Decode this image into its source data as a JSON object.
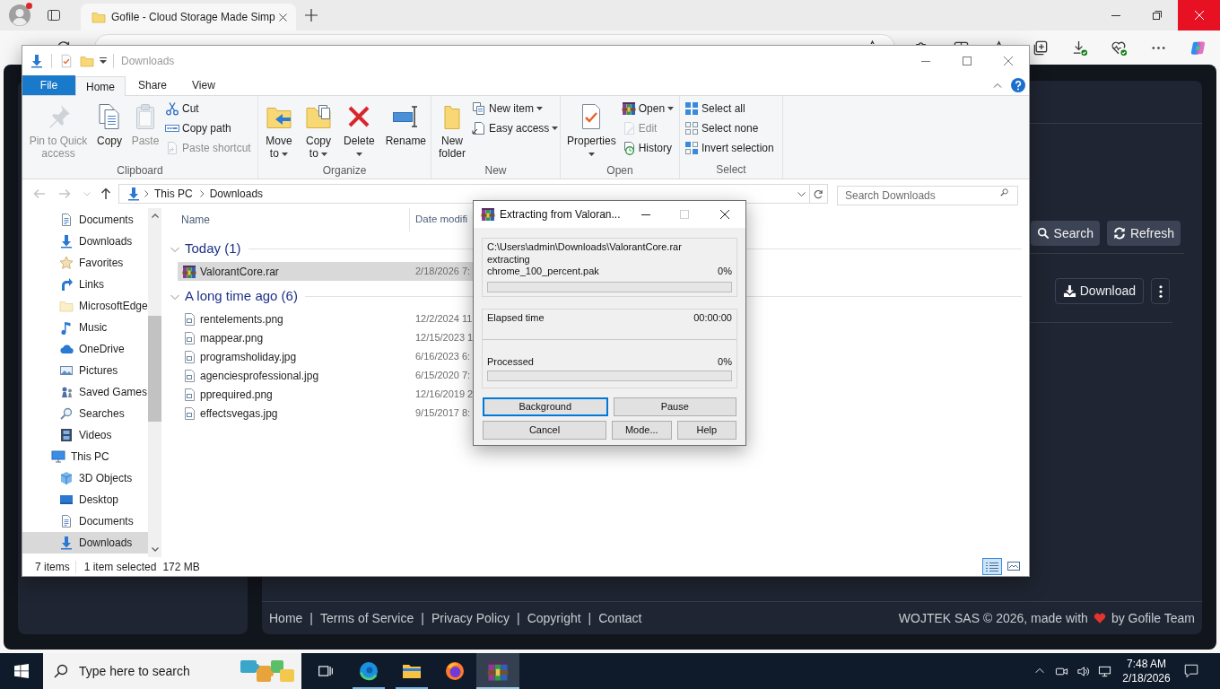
{
  "browser": {
    "profile": {
      "alert": true
    },
    "tabs": [
      {
        "title": "Gofile - Cloud Storage Made Simp",
        "selected": true
      }
    ],
    "close_hovered": true
  },
  "web_page": {
    "toolbar": [
      {
        "kind": "search",
        "label": "Search"
      },
      {
        "kind": "refresh",
        "label": "Refresh"
      }
    ],
    "file_actions": [
      {
        "kind": "download",
        "label": "Download"
      },
      {
        "kind": "more"
      }
    ],
    "footer": {
      "links": [
        "Home",
        "Terms of Service",
        "Privacy Policy",
        "Copyright",
        "Contact"
      ],
      "separator": "|",
      "credit": [
        "WOJTEK SAS © 2026, made with",
        "by Gofile Team"
      ]
    }
  },
  "explorer": {
    "title": "Downloads",
    "ribbon_tabs": [
      {
        "label": "File",
        "kind": "file",
        "selected": false
      },
      {
        "label": "Home",
        "kind": "tab",
        "selected": true
      },
      {
        "label": "Share",
        "kind": "tab",
        "selected": false
      },
      {
        "label": "View",
        "kind": "tab",
        "selected": false
      }
    ],
    "ribbon_groups": [
      {
        "label": "Clipboard",
        "large": [
          {
            "label": "Pin to Quick access",
            "kind": "pin",
            "disabled": true,
            "dropdown": false
          },
          {
            "label": "Copy",
            "kind": "copy",
            "disabled": false,
            "dropdown": false
          },
          {
            "label": "Paste",
            "kind": "paste",
            "disabled": true,
            "dropdown": false
          }
        ],
        "small": [
          {
            "label": "Cut",
            "kind": "cut",
            "disabled": false,
            "dropdown": false
          },
          {
            "label": "Copy path",
            "kind": "copy-path",
            "disabled": false,
            "dropdown": false
          },
          {
            "label": "Paste shortcut",
            "kind": "paste-shortcut",
            "disabled": true,
            "dropdown": false
          }
        ]
      },
      {
        "label": "Organize",
        "large": [
          {
            "label": "Move to",
            "kind": "move-to",
            "disabled": false,
            "dropdown": true
          },
          {
            "label": "Copy to",
            "kind": "copy-to",
            "disabled": false,
            "dropdown": true
          },
          {
            "label": "Delete",
            "kind": "delete",
            "disabled": false,
            "dropdown": true
          },
          {
            "label": "Rename",
            "kind": "rename",
            "disabled": false,
            "dropdown": false
          }
        ]
      },
      {
        "label": "New",
        "large": [
          {
            "label": "New folder",
            "kind": "new-folder",
            "disabled": false,
            "dropdown": false
          }
        ],
        "small": [
          {
            "label": "New item",
            "kind": "new-item",
            "disabled": false,
            "dropdown": true
          },
          {
            "label": "Easy access",
            "kind": "easy-access",
            "disabled": false,
            "dropdown": true
          }
        ]
      },
      {
        "label": "Open",
        "large": [
          {
            "label": "Properties",
            "kind": "properties",
            "disabled": false,
            "dropdown": true
          }
        ],
        "small": [
          {
            "label": "Open",
            "kind": "open",
            "disabled": false,
            "dropdown": true
          },
          {
            "label": "Edit",
            "kind": "edit",
            "disabled": true,
            "dropdown": false
          },
          {
            "label": "History",
            "kind": "history",
            "disabled": false,
            "dropdown": false
          }
        ]
      },
      {
        "label": "Select",
        "small": [
          {
            "label": "Select all",
            "kind": "select-all",
            "disabled": false,
            "dropdown": false
          },
          {
            "label": "Select none",
            "kind": "select-none",
            "disabled": false,
            "dropdown": false
          },
          {
            "label": "Invert selection",
            "kind": "invert-selection",
            "disabled": false,
            "dropdown": false
          }
        ]
      }
    ],
    "nav_buttons": [
      {
        "kind": "back",
        "disabled": true
      },
      {
        "kind": "forward",
        "disabled": true
      },
      {
        "kind": "recent",
        "disabled": true
      },
      {
        "kind": "up",
        "disabled": false
      }
    ],
    "address": {
      "path": [
        "This PC",
        "Downloads"
      ]
    },
    "search": {
      "placeholder": "Search Downloads"
    },
    "nav_pane": {
      "tree": [
        {
          "children": [
            {
              "label": "Documents",
              "kind": "documents",
              "selected": false
            },
            {
              "label": "Downloads",
              "kind": "downloads",
              "selected": false
            },
            {
              "label": "Favorites",
              "kind": "favorites",
              "selected": false
            },
            {
              "label": "Links",
              "kind": "links",
              "selected": false
            },
            {
              "label": "MicrosoftEdge",
              "kind": "folder",
              "selected": false
            },
            {
              "label": "Music",
              "kind": "music",
              "selected": false
            },
            {
              "label": "OneDrive",
              "kind": "onedrive",
              "selected": false
            },
            {
              "label": "Pictures",
              "kind": "pictures",
              "selected": false
            },
            {
              "label": "Saved Games",
              "kind": "saved-games",
              "selected": false
            },
            {
              "label": "Searches",
              "kind": "searches",
              "selected": false
            },
            {
              "label": "Videos",
              "kind": "videos",
              "selected": false
            }
          ]
        },
        {
          "label": "This PC",
          "kind": "this-pc",
          "selected": false,
          "children": [
            {
              "label": "3D Objects",
              "kind": "objects",
              "selected": false
            },
            {
              "label": "Desktop",
              "kind": "desktop",
              "selected": false
            },
            {
              "label": "Documents",
              "kind": "documents",
              "selected": false
            },
            {
              "label": "Downloads",
              "kind": "downloads",
              "selected": true
            }
          ]
        }
      ]
    },
    "columns": [
      "Name",
      "Date modifi"
    ],
    "groups": [
      {
        "label": "Today (1)",
        "expanded": true,
        "files": [
          {
            "name": "ValorantCore.rar",
            "date": "2/18/2026 7:",
            "kind": "archive",
            "selected": true
          }
        ]
      },
      {
        "label": "A long time ago (6)",
        "expanded": true,
        "files": [
          {
            "name": "rentelements.png",
            "date": "12/2/2024 11",
            "kind": "image",
            "selected": false
          },
          {
            "name": "mappear.png",
            "date": "12/15/2023 1",
            "kind": "image",
            "selected": false
          },
          {
            "name": "programsholiday.jpg",
            "date": "6/16/2023 6:",
            "kind": "image",
            "selected": false
          },
          {
            "name": "agenciesprofessional.jpg",
            "date": "6/15/2020 7:",
            "kind": "image",
            "selected": false
          },
          {
            "name": "pprequired.png",
            "date": "12/16/2019 2",
            "kind": "image",
            "selected": false
          },
          {
            "name": "effectsvegas.jpg",
            "date": "9/15/2017 8:",
            "kind": "image",
            "selected": false
          }
        ]
      }
    ],
    "status": {
      "count": "7 items",
      "selection": "1 item selected",
      "size": "172 MB"
    },
    "views": [
      {
        "kind": "details",
        "selected": true
      },
      {
        "kind": "large-icons",
        "selected": false
      }
    ]
  },
  "extract_dialog": {
    "title": "Extracting from Valoran...",
    "maximize_disabled": true,
    "archive_path": "C:\\Users\\admin\\Downloads\\ValorantCore.rar",
    "action": "extracting",
    "current_file": "chrome_100_percent.pak",
    "file_percent": "0%",
    "file_progress": {
      "level": 0
    },
    "elapsed_label": "Elapsed time",
    "elapsed": "00:00:00",
    "processed_label": "Processed",
    "processed_percent": "0%",
    "total_progress": {
      "level": 0
    },
    "button_rows": [
      [
        {
          "label": "Background",
          "default": true
        },
        {
          "label": "Pause",
          "default": false
        }
      ],
      [
        {
          "label": "Cancel",
          "default": false
        },
        {
          "label": "Mode...",
          "default": false
        },
        {
          "label": "Help",
          "default": false
        }
      ]
    ]
  },
  "taskbar": {
    "search": {
      "placeholder": "Type here to search"
    },
    "apps": [
      {
        "kind": "task-view",
        "running": false,
        "active": false
      },
      {
        "kind": "edge",
        "running": true,
        "active": false
      },
      {
        "kind": "explorer",
        "running": true,
        "active": false
      },
      {
        "kind": "firefox",
        "running": false,
        "active": false
      },
      {
        "kind": "winrar",
        "running": true,
        "active": true
      }
    ],
    "clock": {
      "time": "7:48 AM",
      "date": "2/18/2026"
    }
  }
}
